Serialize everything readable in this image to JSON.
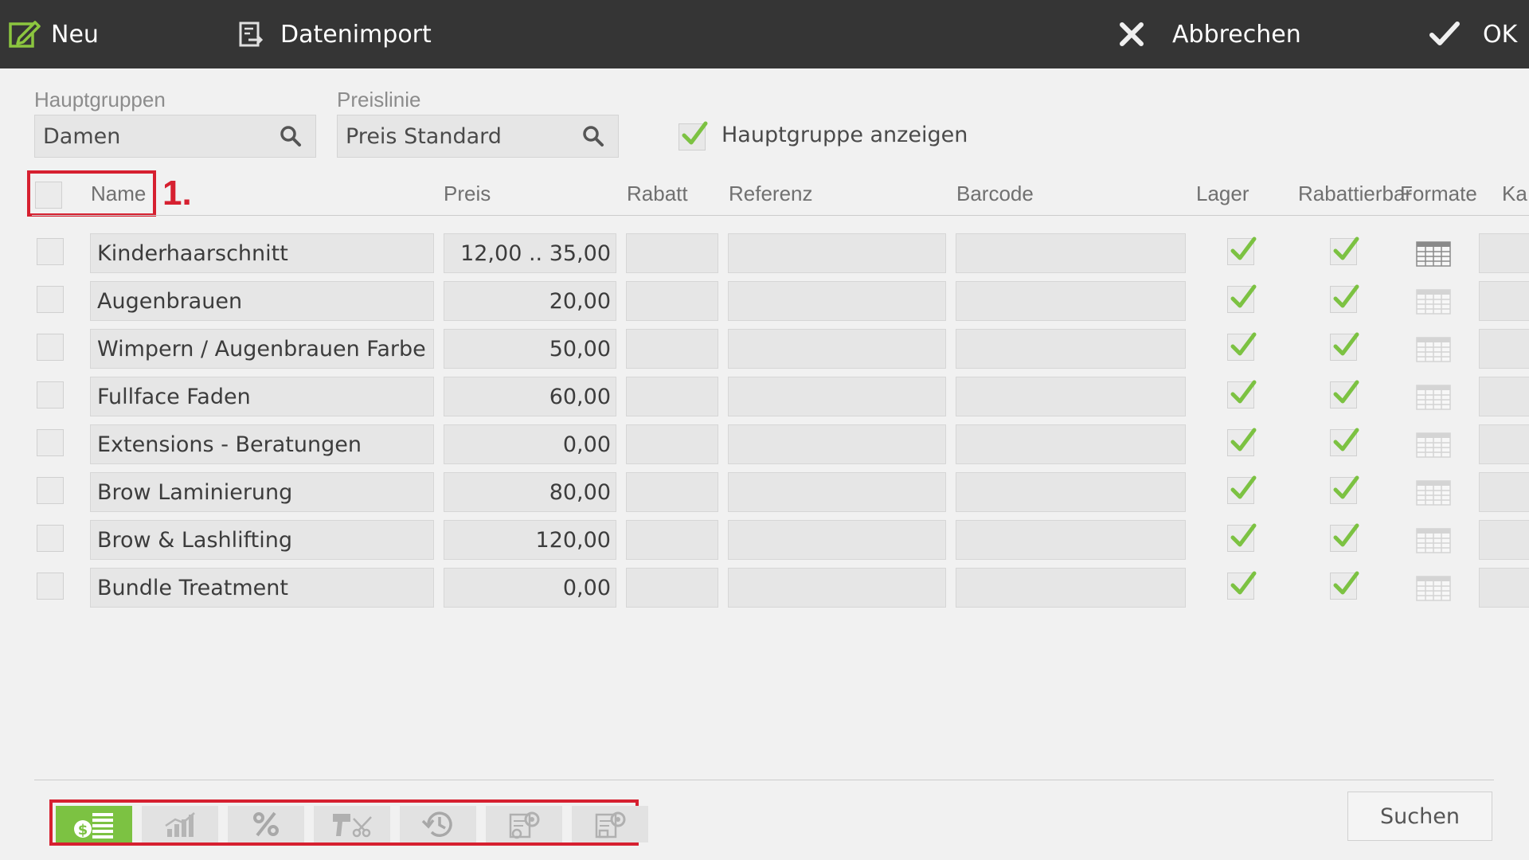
{
  "toolbar": {
    "new_label": "Neu",
    "import_label": "Datenimport",
    "cancel_label": "Abbrechen",
    "ok_label": "OK"
  },
  "filters": {
    "main_group_label": "Hauptgruppen",
    "main_group_value": "Damen",
    "price_line_label": "Preislinie",
    "price_line_value": "Preis Standard",
    "show_main_group_label": "Hauptgruppe anzeigen",
    "show_main_group_checked": true
  },
  "annotation": {
    "step_label": "1."
  },
  "columns": {
    "name": "Name",
    "price": "Preis",
    "discount": "Rabatt",
    "reference": "Referenz",
    "barcode": "Barcode",
    "stock": "Lager",
    "discountable": "Rabattierbar",
    "formats": "Formate",
    "ka": "Ka"
  },
  "rows": [
    {
      "name": "Kinderhaarschnitt",
      "price": "12,00 .. 35,00",
      "stock": true,
      "discountable": true,
      "formats_active": true
    },
    {
      "name": "Augenbrauen",
      "price": "20,00",
      "stock": true,
      "discountable": true,
      "formats_active": false
    },
    {
      "name": "Wimpern / Augenbrauen Farbe",
      "price": "50,00",
      "stock": true,
      "discountable": true,
      "formats_active": false
    },
    {
      "name": "Fullface Faden",
      "price": "60,00",
      "stock": true,
      "discountable": true,
      "formats_active": false
    },
    {
      "name": "Extensions - Beratungen",
      "price": "0,00",
      "stock": true,
      "discountable": true,
      "formats_active": false
    },
    {
      "name": "Brow Laminierung",
      "price": "80,00",
      "stock": true,
      "discountable": true,
      "formats_active": false
    },
    {
      "name": "Brow & Lashlifting",
      "price": "120,00",
      "stock": true,
      "discountable": true,
      "formats_active": false
    },
    {
      "name": "Bundle Treatment",
      "price": "0,00",
      "stock": true,
      "discountable": true,
      "formats_active": false
    }
  ],
  "bottom_tabs": [
    {
      "icon": "price-list-icon",
      "active": true
    },
    {
      "icon": "statistics-icon",
      "active": false
    },
    {
      "icon": "percent-icon",
      "active": false
    },
    {
      "icon": "hairdryer-scissors-icon",
      "active": false
    },
    {
      "icon": "history-icon",
      "active": false
    },
    {
      "icon": "service-settings-icon",
      "active": false
    },
    {
      "icon": "product-settings-icon",
      "active": false
    }
  ],
  "search_button_label": "Suchen",
  "colors": {
    "toolbar_bg": "#353535",
    "accent_green": "#7cc242",
    "annotation_red": "#d62030",
    "field_bg": "#e6e6e6"
  }
}
